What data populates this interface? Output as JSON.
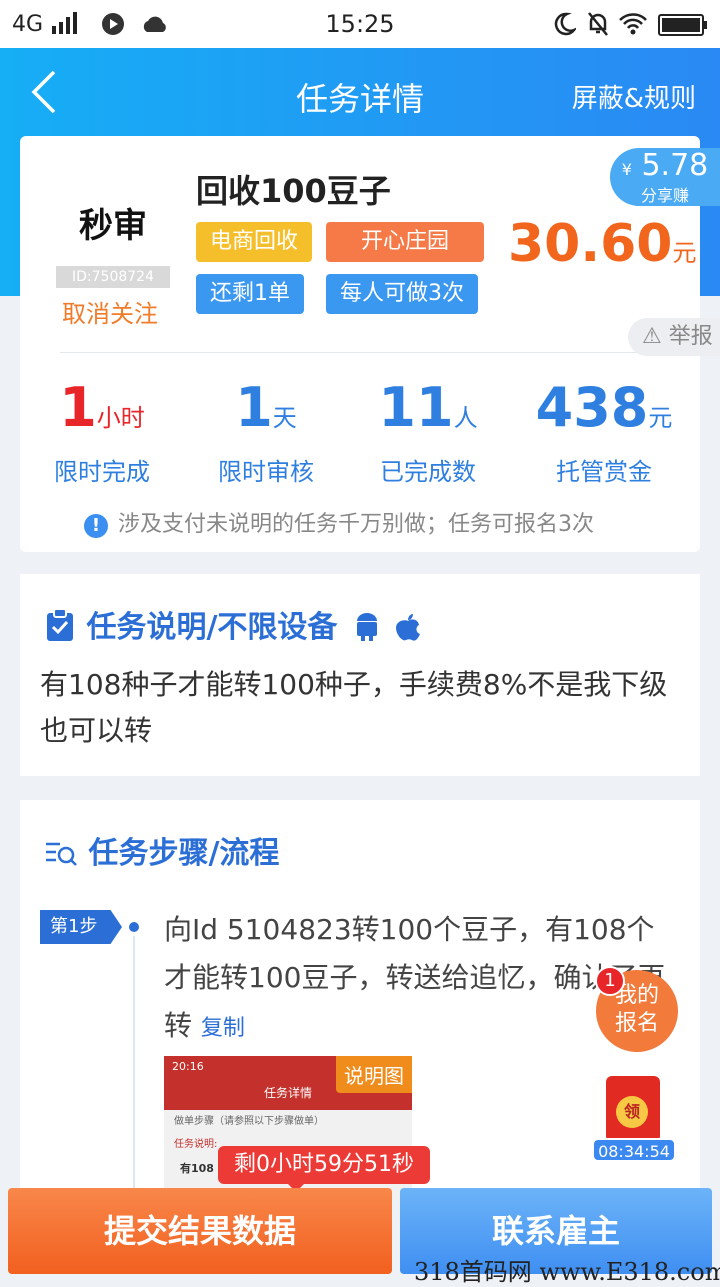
{
  "status_bar": {
    "network": "4G",
    "time": "15:25"
  },
  "header": {
    "title": "任务详情",
    "rules": "屏蔽&规则"
  },
  "task": {
    "logo_text": "秒审",
    "logo_id": "ID:7508724",
    "unfollow": "取消关注",
    "name": "回收100豆子",
    "tags": [
      "电商回收",
      "开心庄园",
      "还剩1单",
      "每人可做3次"
    ],
    "share_amount": "5.78",
    "share_currency": "¥",
    "share_label": "分享赚",
    "reward": "30.60",
    "reward_unit": "元",
    "report": "举报"
  },
  "stats": [
    {
      "value": "1",
      "unit": "小时",
      "label": "限时完成",
      "color": "#e8262a"
    },
    {
      "value": "1",
      "unit": "天",
      "label": "限时审核",
      "color": "#2f7fe0"
    },
    {
      "value": "11",
      "unit": "人",
      "label": "已完成数",
      "color": "#2f7fe0"
    },
    {
      "value": "438",
      "unit": "元",
      "label": "托管赏金",
      "color": "#2f7fe0"
    }
  ],
  "notice": "涉及支付未说明的任务千万别做；任务可报名3次",
  "description": {
    "title": "任务说明/不限设备",
    "text": "有108种子才能转100种子，手续费8%不是我下级也可以转"
  },
  "steps": {
    "title": "任务步骤/流程",
    "step_label": "第1步",
    "step_text": "向Id 5104823转100个豆子，有108个才能转100豆子，转送给追忆，确认了再转",
    "copy": "复制",
    "image_label": "说明图",
    "thumb": {
      "time": "20:16",
      "title": "任务详情",
      "line1": "做单步骤（请参照以下步骤做单）",
      "line2": "任务说明:",
      "line3": "有108"
    }
  },
  "float": {
    "my_signup": "我的报名",
    "badge": "1",
    "gift_label": "领",
    "gift_timer": "08:34:54"
  },
  "countdown": "剩0小时59分51秒",
  "buttons": {
    "submit": "提交结果数据",
    "contact": "联系雇主"
  },
  "watermark": "318首码网 www.E318.com"
}
